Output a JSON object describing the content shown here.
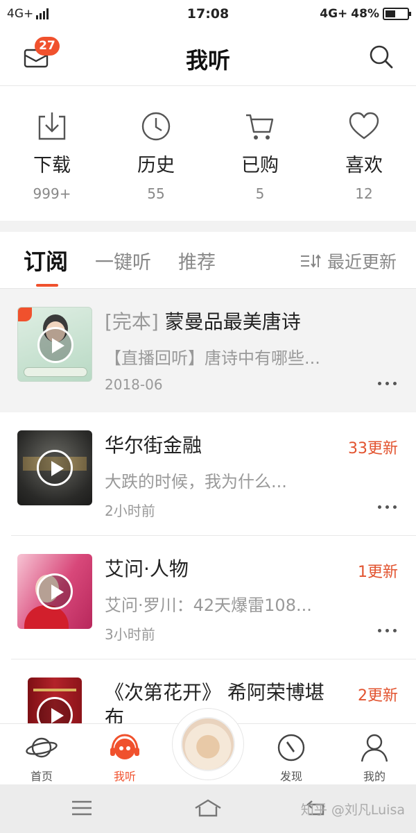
{
  "status_bar": {
    "network_left": "4G+",
    "time": "17:08",
    "network_right": "4G+",
    "battery": "48%",
    "battery_level": 0.48
  },
  "header": {
    "title": "我听",
    "mail_badge": "27",
    "mail_icon": "mail-icon",
    "search_icon": "search-icon"
  },
  "quick_actions": [
    {
      "label": "下载",
      "count": "999+",
      "icon": "download-icon"
    },
    {
      "label": "历史",
      "count": "55",
      "icon": "clock-icon"
    },
    {
      "label": "已购",
      "count": "5",
      "icon": "cart-icon"
    },
    {
      "label": "喜欢",
      "count": "12",
      "icon": "heart-icon"
    }
  ],
  "tabs": {
    "items": [
      "订阅",
      "一键听",
      "推荐"
    ],
    "active": "订阅",
    "sort_label": "最近更新"
  },
  "subscriptions": [
    {
      "tag": "[完本]",
      "title": "蒙曼品最美唐诗",
      "desc": "【直播回听】唐诗中有哪些...",
      "time": "2018-06",
      "update": ""
    },
    {
      "tag": "",
      "title": "华尔街金融",
      "desc": "大跌的时候，我为什么...",
      "time": "2小时前",
      "update": "33更新"
    },
    {
      "tag": "",
      "title": "艾问·人物",
      "desc": "艾问·罗川：42天爆雷108...",
      "time": "3小时前",
      "update": "1更新"
    },
    {
      "tag": "",
      "title": "《次第花开》 希阿荣博堪布",
      "desc": "",
      "time": "",
      "update": "2更新"
    }
  ],
  "bottom_nav": [
    {
      "label": "首页",
      "icon": "planet-icon"
    },
    {
      "label": "我听",
      "icon": "headphone-face-icon"
    },
    {
      "label": "发现",
      "icon": "compass-icon"
    },
    {
      "label": "我的",
      "icon": "person-icon"
    }
  ],
  "watermark": "知乎 @刘凡Luisa",
  "colors": {
    "accent": "#f0512d",
    "update_text": "#e2532f"
  }
}
